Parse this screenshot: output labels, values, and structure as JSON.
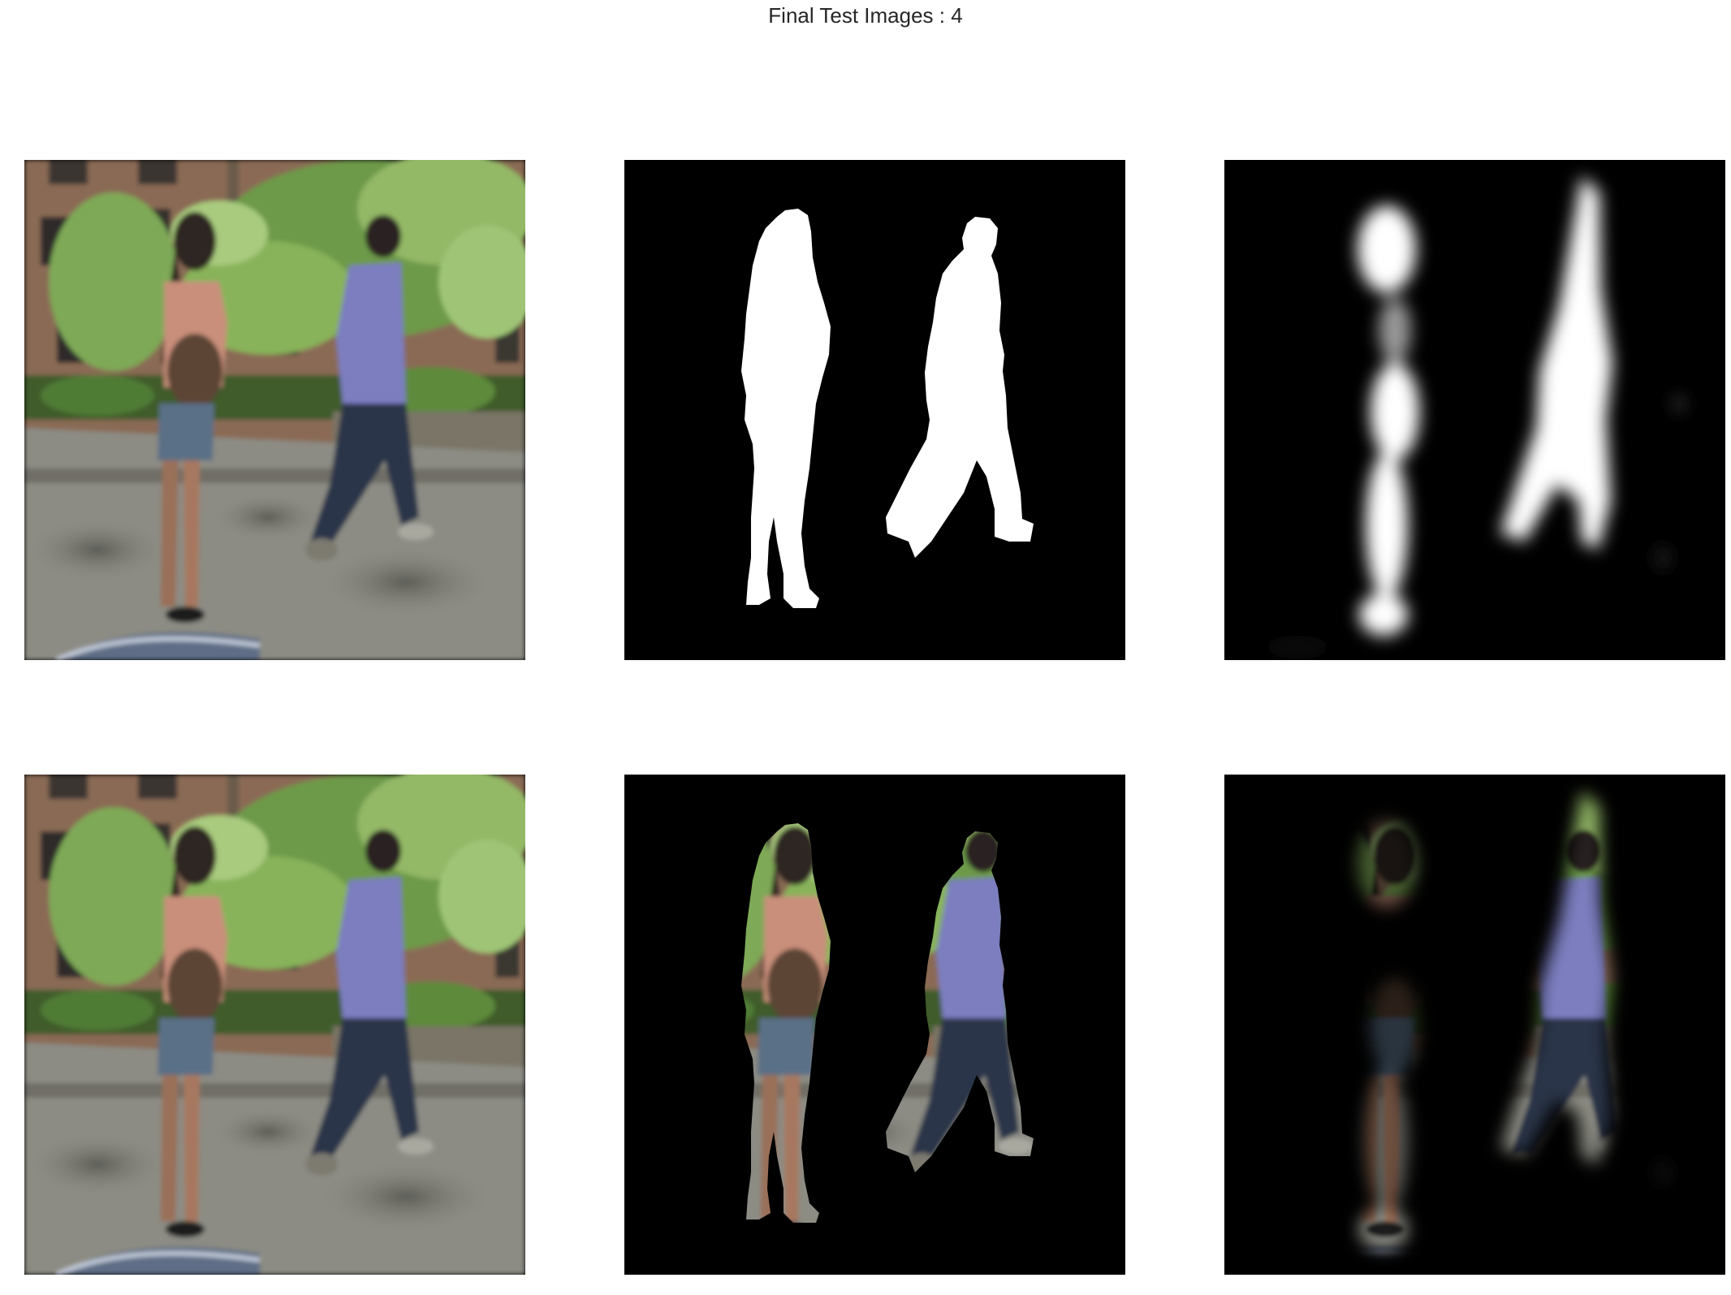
{
  "figure": {
    "title": "Final Test Images : 4"
  },
  "panels": [
    {
      "row": 1,
      "col": 1,
      "content": "input-photo"
    },
    {
      "row": 1,
      "col": 2,
      "content": "ground-truth-mask"
    },
    {
      "row": 1,
      "col": 3,
      "content": "predicted-mask"
    },
    {
      "row": 2,
      "col": 1,
      "content": "input-photo"
    },
    {
      "row": 2,
      "col": 2,
      "content": "ground-truth-masked-photo"
    },
    {
      "row": 2,
      "col": 3,
      "content": "predicted-masked-photo"
    }
  ],
  "colors": {
    "background": "#ffffff",
    "title_text": "#262626",
    "mask_background": "#000000",
    "mask_foreground": "#ffffff",
    "building_brick": "#8a6a55",
    "foliage": "#6d9a4a",
    "pavement": "#8c8c84",
    "woman_top": "#c98f7a",
    "woman_skirt": "#5a6f86",
    "man_shirt": "#7b7ec0",
    "man_jeans": "#2c3448"
  }
}
